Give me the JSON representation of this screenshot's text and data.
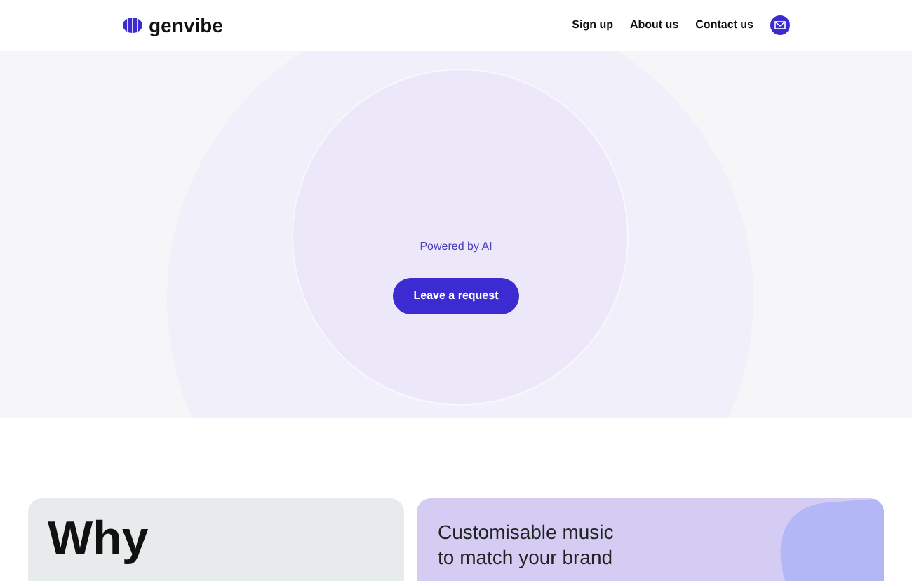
{
  "header": {
    "logo": "genvibe",
    "nav": [
      {
        "label": "Sign up"
      },
      {
        "label": "About us"
      },
      {
        "label": "Contact us"
      }
    ]
  },
  "hero": {
    "tagline": "Powered by AI",
    "button": "Leave a request"
  },
  "cards": [
    {
      "kind": "heading",
      "title": "Why"
    },
    {
      "kind": "feature",
      "title": "Customisable music to match your brand"
    }
  ]
}
